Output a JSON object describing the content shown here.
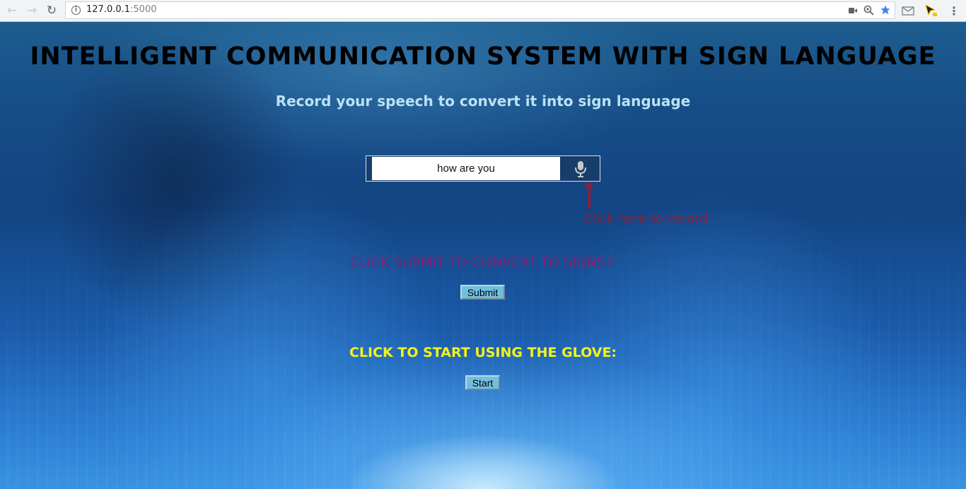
{
  "browser": {
    "url_host": "127.0.0.1",
    "url_port": ":5000",
    "back_icon": "arrow-left-icon",
    "forward_icon": "arrow-right-icon",
    "reload_icon": "reload-icon",
    "info_icon": "info-icon",
    "info_glyph": "i",
    "camera_icon": "camera-icon",
    "zoom_icon": "zoom-icon",
    "bookmark_icon": "star-icon",
    "bookmark_color": "#4285f4",
    "menu_icon": "kebab-menu-icon"
  },
  "page": {
    "title": "INTELLIGENT COMMUNICATION SYSTEM WITH SIGN LANGUAGE",
    "subtitle": "Record your speech to convert it into sign language",
    "speech_input_value": "how are you",
    "mic_icon": "microphone-icon",
    "record_hint": "Click here to record",
    "submit_prompt": "CLICK SUBMIT TO CONVERT TO SIGNS!!",
    "submit_label": "Submit",
    "glove_prompt": "CLICK TO START USING THE GLOVE:",
    "start_label": "Start"
  },
  "colors": {
    "title": "#000000",
    "subtitle": "#b9e3f5",
    "record_hint": "#8c1f3a",
    "submit_prompt": "#8c1d6f",
    "glove_prompt": "#f4f21c",
    "button_bg": "#6fc0e0"
  }
}
